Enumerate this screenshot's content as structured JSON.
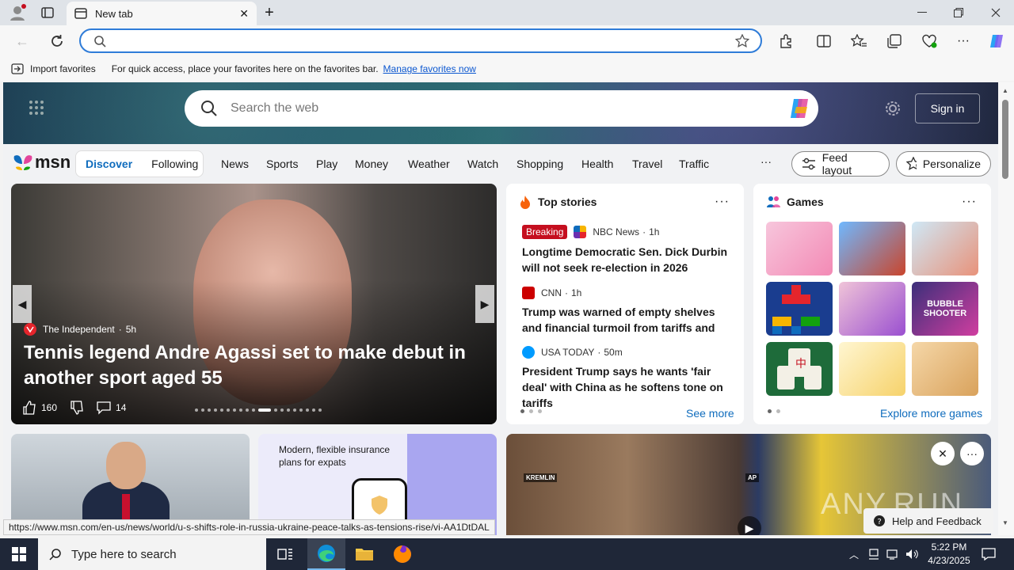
{
  "browser": {
    "tab_title": "New tab",
    "address_value": "",
    "favorites_bar": {
      "import_label": "Import favorites",
      "message": "For quick access, place your favorites here on the favorites bar.",
      "manage_link": "Manage favorites now"
    },
    "status_url": "https://www.msn.com/en-us/news/world/u-s-shifts-role-in-russia-ukraine-peace-talks-as-tensions-rise/vi-AA1DtDAL"
  },
  "msn": {
    "search_placeholder": "Search the web",
    "sign_in": "Sign in",
    "logo_text": "msn",
    "feed_tabs": [
      "Discover",
      "Following"
    ],
    "nav": [
      "News",
      "Sports",
      "Play",
      "Money",
      "Weather",
      "Watch",
      "Shopping",
      "Health",
      "Travel",
      "Traffic"
    ],
    "nav_more": "···",
    "feed_layout": "Feed layout",
    "personalize": "Personalize",
    "carousel": {
      "source": "The Independent",
      "age": "5h",
      "title": "Tennis legend Andre Agassi set to make debut in another sport aged 55",
      "likes": "160",
      "comments": "14"
    },
    "top_stories": {
      "heading": "Top stories",
      "items": [
        {
          "badge": "Breaking",
          "source": "NBC News",
          "age": "1h",
          "headline": "Longtime Democratic Sen. Dick Durbin will not seek re-election in 2026"
        },
        {
          "badge": "",
          "source": "CNN",
          "age": "1h",
          "headline": "Trump was warned of empty shelves and financial turmoil from tariffs and firing..."
        },
        {
          "badge": "",
          "source": "USA TODAY",
          "age": "50m",
          "headline": "President Trump says he wants 'fair deal' with China as he softens tone on tariffs"
        }
      ],
      "see_more": "See more"
    },
    "games": {
      "heading": "Games",
      "explore": "Explore more games",
      "bubble_text": "BUBBLE SHOOTER"
    },
    "promo": {
      "text": "Modern, flexible insurance plans for expats"
    },
    "video_tags": {
      "left": "KREMLIN",
      "right": "AP"
    },
    "feedback": "Help and Feedback",
    "watermark": "ANY.RUN"
  },
  "taskbar": {
    "search_placeholder": "Type here to search",
    "time": "5:22 PM",
    "date": "4/23/2025"
  },
  "colors": {
    "accent": "#0f6cbd",
    "address_border": "#2f7cd8",
    "breaking": "#c50f1f",
    "taskbar": "#1f2738"
  }
}
